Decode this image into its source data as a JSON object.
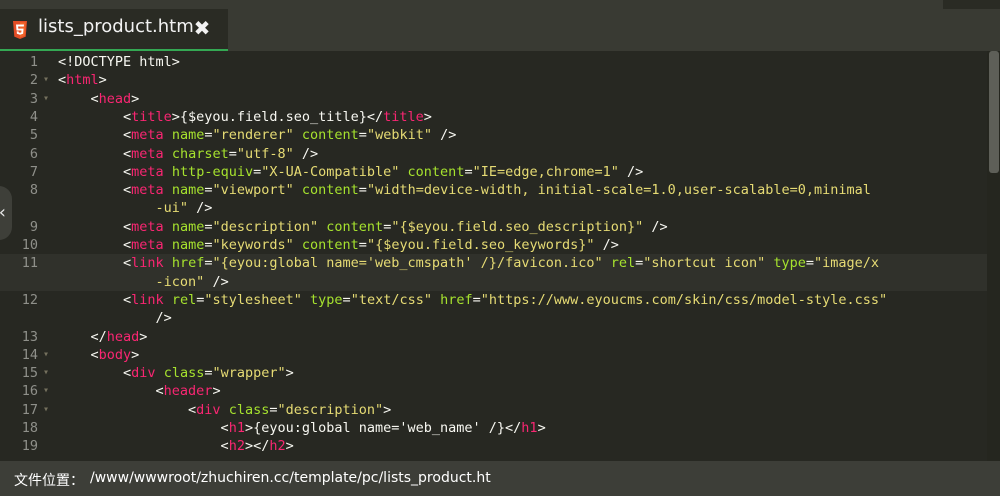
{
  "tab": {
    "icon": "html5-icon",
    "title": "lists_product.htm",
    "close": "✖"
  },
  "editor": {
    "lines": [
      {
        "n": "1",
        "fold": "",
        "segs": [
          [
            "p",
            "<!DOCTYPE html>"
          ]
        ]
      },
      {
        "n": "2",
        "fold": "▾",
        "segs": [
          [
            "p",
            "<"
          ],
          [
            "t",
            "html"
          ],
          [
            "p",
            ">"
          ]
        ]
      },
      {
        "n": "3",
        "fold": "▾",
        "segs": [
          [
            "p",
            "    <"
          ],
          [
            "t",
            "head"
          ],
          [
            "p",
            ">"
          ]
        ]
      },
      {
        "n": "4",
        "fold": "",
        "segs": [
          [
            "p",
            "        <"
          ],
          [
            "t",
            "title"
          ],
          [
            "p",
            ">{$eyou.field.seo_title}</"
          ],
          [
            "t",
            "title"
          ],
          [
            "p",
            ">"
          ]
        ]
      },
      {
        "n": "5",
        "fold": "",
        "segs": [
          [
            "p",
            "        <"
          ],
          [
            "t",
            "meta"
          ],
          [
            "p",
            " "
          ],
          [
            "a",
            "name"
          ],
          [
            "p",
            "="
          ],
          [
            "s",
            "\"renderer\""
          ],
          [
            "p",
            " "
          ],
          [
            "a",
            "content"
          ],
          [
            "p",
            "="
          ],
          [
            "s",
            "\"webkit\""
          ],
          [
            "p",
            " />"
          ]
        ]
      },
      {
        "n": "6",
        "fold": "",
        "segs": [
          [
            "p",
            "        <"
          ],
          [
            "t",
            "meta"
          ],
          [
            "p",
            " "
          ],
          [
            "a",
            "charset"
          ],
          [
            "p",
            "="
          ],
          [
            "s",
            "\"utf-8\""
          ],
          [
            "p",
            " />"
          ]
        ]
      },
      {
        "n": "7",
        "fold": "",
        "segs": [
          [
            "p",
            "        <"
          ],
          [
            "t",
            "meta"
          ],
          [
            "p",
            " "
          ],
          [
            "a",
            "http-equiv"
          ],
          [
            "p",
            "="
          ],
          [
            "s",
            "\"X-UA-Compatible\""
          ],
          [
            "p",
            " "
          ],
          [
            "a",
            "content"
          ],
          [
            "p",
            "="
          ],
          [
            "s",
            "\"IE=edge,chrome=1\""
          ],
          [
            "p",
            " />"
          ]
        ]
      },
      {
        "n": "8",
        "fold": "",
        "segs": [
          [
            "p",
            "        <"
          ],
          [
            "t",
            "meta"
          ],
          [
            "p",
            " "
          ],
          [
            "a",
            "name"
          ],
          [
            "p",
            "="
          ],
          [
            "s",
            "\"viewport\""
          ],
          [
            "p",
            " "
          ],
          [
            "a",
            "content"
          ],
          [
            "p",
            "="
          ],
          [
            "s",
            "\"width=device-width, initial-scale=1.0,user-scalable=0,minimal"
          ]
        ]
      },
      {
        "n": "",
        "fold": "",
        "segs": [
          [
            "s",
            "            -ui\""
          ],
          [
            "p",
            " />"
          ]
        ]
      },
      {
        "n": "9",
        "fold": "",
        "segs": [
          [
            "p",
            "        <"
          ],
          [
            "t",
            "meta"
          ],
          [
            "p",
            " "
          ],
          [
            "a",
            "name"
          ],
          [
            "p",
            "="
          ],
          [
            "s",
            "\"description\""
          ],
          [
            "p",
            " "
          ],
          [
            "a",
            "content"
          ],
          [
            "p",
            "="
          ],
          [
            "s",
            "\"{$eyou.field.seo_description}\""
          ],
          [
            "p",
            " />"
          ]
        ]
      },
      {
        "n": "10",
        "fold": "",
        "segs": [
          [
            "p",
            "        <"
          ],
          [
            "t",
            "meta"
          ],
          [
            "p",
            " "
          ],
          [
            "a",
            "name"
          ],
          [
            "p",
            "="
          ],
          [
            "s",
            "\"keywords\""
          ],
          [
            "p",
            " "
          ],
          [
            "a",
            "content"
          ],
          [
            "p",
            "="
          ],
          [
            "s",
            "\"{$eyou.field.seo_keywords}\""
          ],
          [
            "p",
            " />"
          ]
        ]
      },
      {
        "n": "11",
        "fold": "",
        "active": true,
        "segs": [
          [
            "p",
            "        <"
          ],
          [
            "t",
            "link"
          ],
          [
            "p",
            " "
          ],
          [
            "a",
            "href"
          ],
          [
            "p",
            "="
          ],
          [
            "s",
            "\"{eyou:global name='web_cmspath' /}/favicon.ico\""
          ],
          [
            "p",
            " "
          ],
          [
            "a",
            "rel"
          ],
          [
            "p",
            "="
          ],
          [
            "s",
            "\"shortcut icon\""
          ],
          [
            "p",
            " "
          ],
          [
            "a",
            "type"
          ],
          [
            "p",
            "="
          ],
          [
            "s",
            "\"image/x"
          ]
        ]
      },
      {
        "n": "",
        "fold": "",
        "active": true,
        "segs": [
          [
            "s",
            "            -icon\""
          ],
          [
            "p",
            " />"
          ]
        ]
      },
      {
        "n": "12",
        "fold": "",
        "segs": [
          [
            "p",
            "        <"
          ],
          [
            "t",
            "link"
          ],
          [
            "p",
            " "
          ],
          [
            "a",
            "rel"
          ],
          [
            "p",
            "="
          ],
          [
            "s",
            "\"stylesheet\""
          ],
          [
            "p",
            " "
          ],
          [
            "a",
            "type"
          ],
          [
            "p",
            "="
          ],
          [
            "s",
            "\"text/css\""
          ],
          [
            "p",
            " "
          ],
          [
            "a",
            "href"
          ],
          [
            "p",
            "="
          ],
          [
            "s",
            "\"https://www.eyoucms.com/skin/css/model-style.css\""
          ]
        ]
      },
      {
        "n": "",
        "fold": "",
        "segs": [
          [
            "p",
            "            />"
          ]
        ]
      },
      {
        "n": "13",
        "fold": "",
        "segs": [
          [
            "p",
            "    </"
          ],
          [
            "t",
            "head"
          ],
          [
            "p",
            ">"
          ]
        ]
      },
      {
        "n": "14",
        "fold": "▾",
        "segs": [
          [
            "p",
            "    <"
          ],
          [
            "t",
            "body"
          ],
          [
            "p",
            ">"
          ]
        ]
      },
      {
        "n": "15",
        "fold": "▾",
        "segs": [
          [
            "p",
            "        <"
          ],
          [
            "t",
            "div"
          ],
          [
            "p",
            " "
          ],
          [
            "a",
            "class"
          ],
          [
            "p",
            "="
          ],
          [
            "s",
            "\"wrapper\""
          ],
          [
            "p",
            ">"
          ]
        ]
      },
      {
        "n": "16",
        "fold": "▾",
        "segs": [
          [
            "p",
            "            <"
          ],
          [
            "t",
            "header"
          ],
          [
            "p",
            ">"
          ]
        ]
      },
      {
        "n": "17",
        "fold": "▾",
        "segs": [
          [
            "p",
            "                <"
          ],
          [
            "t",
            "div"
          ],
          [
            "p",
            " "
          ],
          [
            "a",
            "class"
          ],
          [
            "p",
            "="
          ],
          [
            "s",
            "\"description\""
          ],
          [
            "p",
            ">"
          ]
        ]
      },
      {
        "n": "18",
        "fold": "",
        "segs": [
          [
            "p",
            "                    <"
          ],
          [
            "t",
            "h1"
          ],
          [
            "p",
            ">{eyou:global name='web_name' /}</"
          ],
          [
            "t",
            "h1"
          ],
          [
            "p",
            ">"
          ]
        ]
      },
      {
        "n": "19",
        "fold": "",
        "segs": [
          [
            "p",
            "                    <"
          ],
          [
            "t",
            "h2"
          ],
          [
            "p",
            "></"
          ],
          [
            "t",
            "h2"
          ],
          [
            "p",
            ">"
          ]
        ]
      }
    ]
  },
  "side_handle": {
    "icon": "chevron-left-icon",
    "glyph": "‹"
  },
  "status": {
    "label": "文件位置：",
    "path": "/www/wwwroot/zhuchiren.cc/template/pc/lists_product.htm"
  }
}
